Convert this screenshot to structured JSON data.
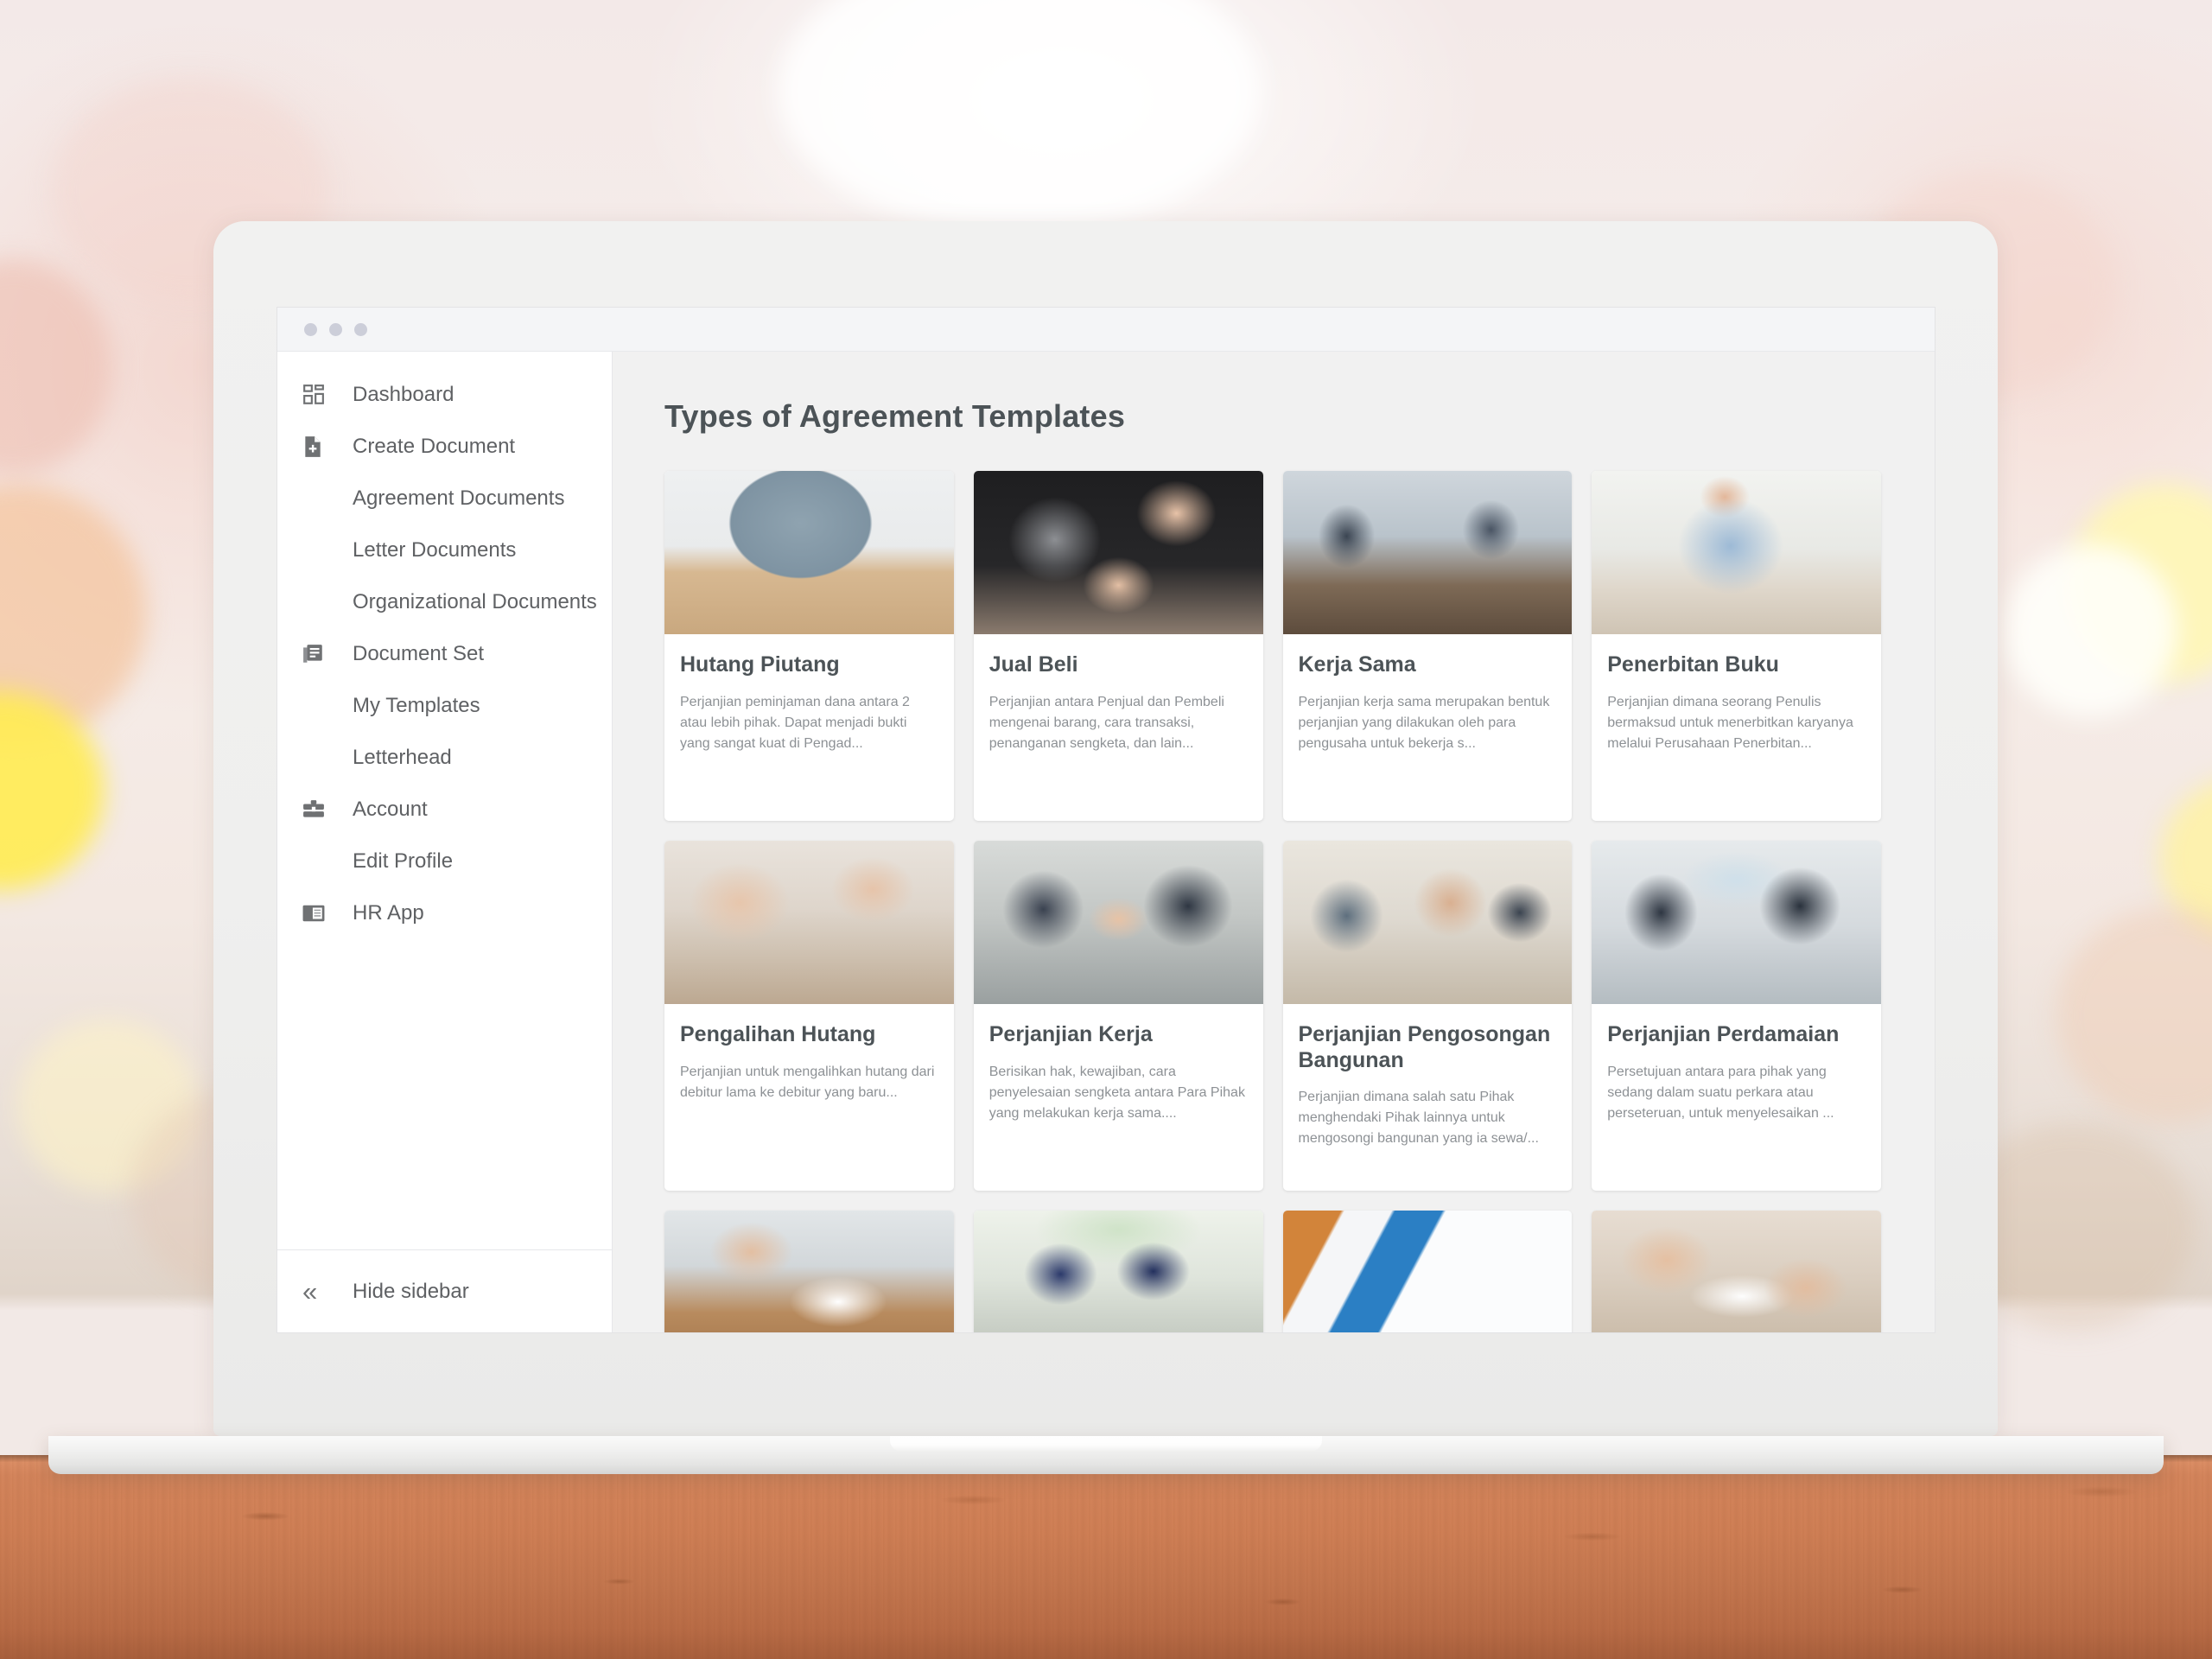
{
  "window": {
    "dots": [
      "window-dot-1",
      "window-dot-2",
      "window-dot-3"
    ]
  },
  "sidebar": {
    "items": [
      {
        "label": "Dashboard",
        "icon": "dashboard-grid-icon",
        "level": "top"
      },
      {
        "label": "Create Document",
        "icon": "document-plus-icon",
        "level": "top"
      },
      {
        "label": "Agreement Documents",
        "icon": "",
        "level": "sub"
      },
      {
        "label": "Letter Documents",
        "icon": "",
        "level": "sub"
      },
      {
        "label": "Organizational Documents",
        "icon": "",
        "level": "sub"
      },
      {
        "label": "Document Set",
        "icon": "document-stack-icon",
        "level": "top"
      },
      {
        "label": "My Templates",
        "icon": "",
        "level": "sub"
      },
      {
        "label": "Letterhead",
        "icon": "",
        "level": "sub"
      },
      {
        "label": "Account",
        "icon": "briefcase-icon",
        "level": "top"
      },
      {
        "label": "Edit Profile",
        "icon": "",
        "level": "sub"
      },
      {
        "label": "HR App",
        "icon": "id-card-icon",
        "level": "top"
      }
    ],
    "footer": {
      "label": "Hide sidebar",
      "icon": "double-chevron-left-icon"
    }
  },
  "main": {
    "title": "Types of Agreement Templates",
    "cards": [
      {
        "title": "Hutang Piutang",
        "description": "Perjanjian peminjaman dana antara 2 atau lebih pihak. Dapat menjadi bukti yang sangat kuat di Pengad...",
        "thumb": "person-signing-with-calculator-photo"
      },
      {
        "title": "Jual Beli",
        "description": "Perjanjian antara Penjual dan Pembeli mengenai barang, cara transaksi, penanganan sengketa, dan lain...",
        "thumb": "handing-over-house-keys-photo"
      },
      {
        "title": "Kerja Sama",
        "description": "Perjanjian kerja sama merupakan bentuk perjanjian yang dilakukan oleh para pengusaha untuk bekerja s...",
        "thumb": "team-meeting-boardroom-photo"
      },
      {
        "title": "Penerbitan Buku",
        "description": "Perjanjian dimana seorang Penulis bermaksud untuk menerbitkan karyanya melalui Perusahaan Penerbitan...",
        "thumb": "woman-reading-document-at-desk-photo"
      },
      {
        "title": "Pengalihan Hutang",
        "description": "Perjanjian untuk mengalihkan hutang dari debitur lama ke debitur yang baru...",
        "thumb": "hands-on-keyboard-calculator-photo"
      },
      {
        "title": "Perjanjian Kerja",
        "description": "Berisikan hak, kewajiban, cara penyelesaian sengketa antara Para Pihak yang melakukan kerja sama....",
        "thumb": "business-handshake-photo"
      },
      {
        "title": "Perjanjian Pengosongan Bangunan",
        "description": "Perjanjian dimana salah satu Pihak menghendaki Pihak lainnya untuk mengosongi bangunan yang ia sewa/...",
        "thumb": "two-men-discussing-at-table-photo"
      },
      {
        "title": "Perjanjian Perdamaian",
        "description": "Persetujuan antara para pihak yang sedang dalam suatu perkara atau perseteruan, untuk menyelesaikan ...",
        "thumb": "handshake-in-front-of-whiteboard-photo"
      }
    ],
    "partial_cards": [
      {
        "thumb": "hands-reviewing-charts-photo"
      },
      {
        "thumb": "two-colleagues-working-photo"
      },
      {
        "thumb": "rental-agreement-with-house-key-photo"
      },
      {
        "thumb": "people-signing-papers-photo"
      }
    ]
  },
  "colors": {
    "page_background": "#f1f1f1",
    "sidebar_background": "#ffffff",
    "card_background": "#ffffff",
    "title_text": "#4c5357",
    "body_text": "#8d9195",
    "nav_text": "#5f6164",
    "chrome_bar": "#f4f5f7",
    "window_dot": "#ccced9",
    "desk_wood": "#cf7f55",
    "laptop_shell": "#efefee"
  }
}
